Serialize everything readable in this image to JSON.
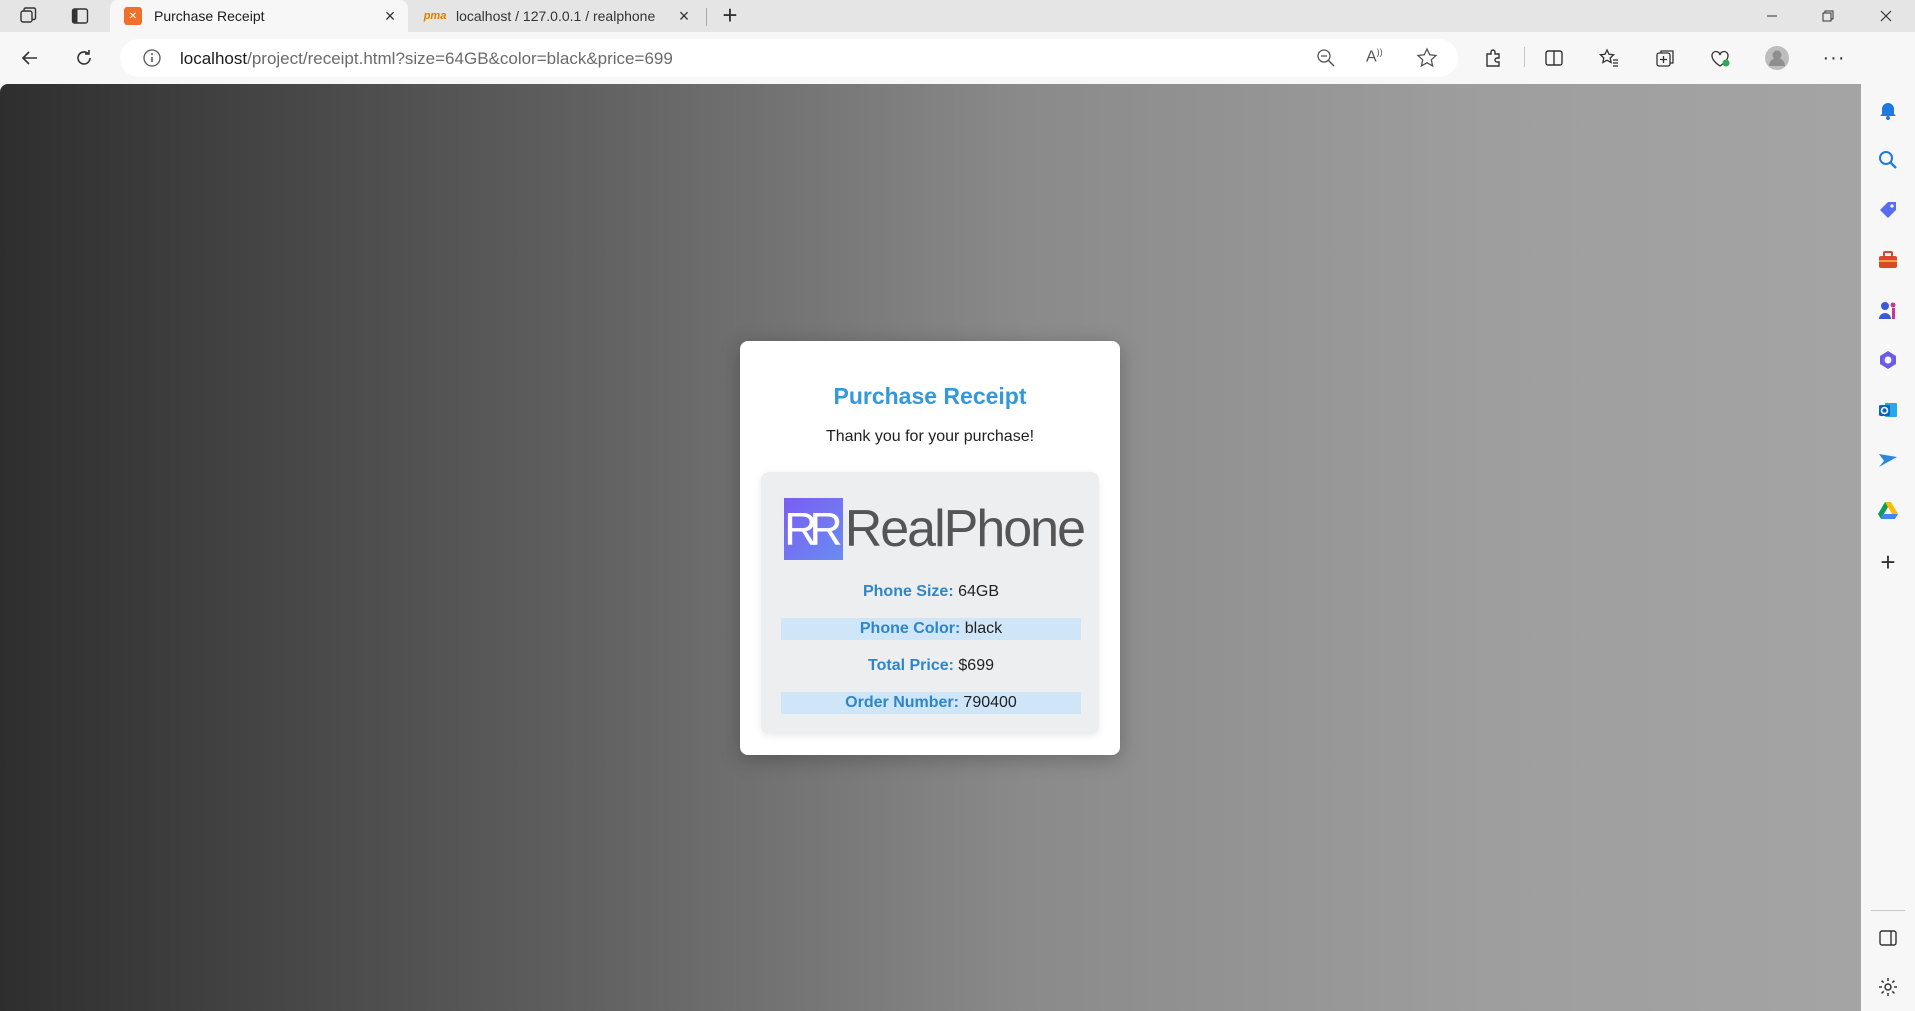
{
  "tabs": [
    {
      "title": "Purchase Receipt",
      "favicon": "xampp-icon",
      "active": true
    },
    {
      "title": "localhost / 127.0.0.1 / realphone",
      "favicon": "phpmyadmin-icon",
      "active": false
    }
  ],
  "address_bar": {
    "host": "localhost",
    "path": "/project/receipt.html?size=64GB&color=black&price=699"
  },
  "receipt": {
    "title": "Purchase Receipt",
    "thanks": "Thank you for your purchase!",
    "logo_mark": "R",
    "logo_text": "RealPhone",
    "size_label": "Phone Size:",
    "size_value": "64GB",
    "color_label": "Phone Color:",
    "color_value": "black",
    "price_label": "Total Price:",
    "price_value": "$699",
    "order_label": "Order Number:",
    "order_value": "790400"
  },
  "colors": {
    "accent": "#3498db",
    "highlight_row": "#cfe5f8"
  }
}
